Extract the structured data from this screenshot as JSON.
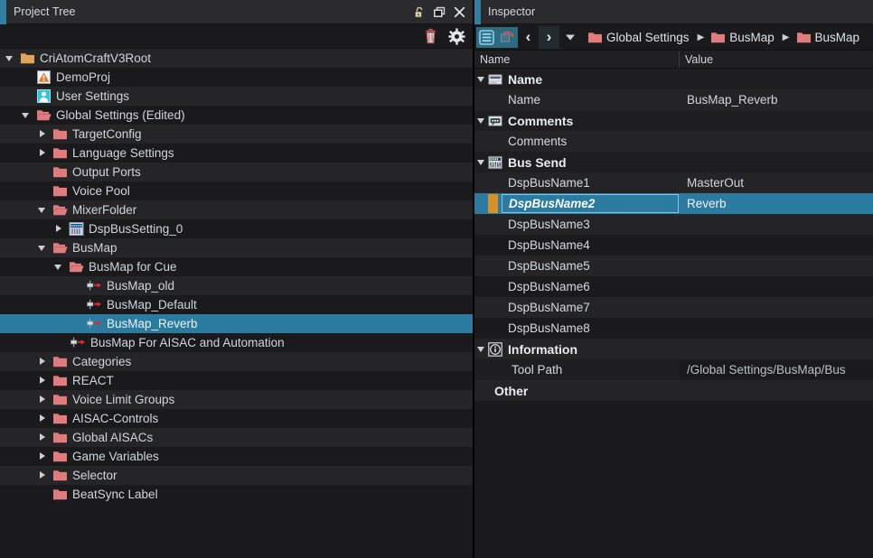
{
  "tree_panel": {
    "title": "Project Tree",
    "title_buttons": [
      "lock-icon",
      "restore-icon",
      "close-icon"
    ],
    "toolbar": [
      "delete-icon",
      "settings-icon"
    ],
    "items": [
      {
        "label": "CriAtomCraftV3Root",
        "indent": 0,
        "arrow": "open",
        "icon": "folder-orange",
        "selected": false
      },
      {
        "label": "DemoProj",
        "indent": 1,
        "arrow": "none",
        "icon": "project-icon",
        "selected": false
      },
      {
        "label": "User Settings",
        "indent": 1,
        "arrow": "none",
        "icon": "user-icon",
        "selected": false
      },
      {
        "label": "Global Settings (Edited)",
        "indent": 1,
        "arrow": "open",
        "icon": "folder-open-red",
        "selected": false
      },
      {
        "label": "TargetConfig",
        "indent": 2,
        "arrow": "closed",
        "icon": "folder-red",
        "selected": false
      },
      {
        "label": "Language Settings",
        "indent": 2,
        "arrow": "closed",
        "icon": "folder-red",
        "selected": false
      },
      {
        "label": "Output Ports",
        "indent": 2,
        "arrow": "none",
        "icon": "folder-red",
        "selected": false
      },
      {
        "label": "Voice Pool",
        "indent": 2,
        "arrow": "none",
        "icon": "folder-red",
        "selected": false
      },
      {
        "label": "MixerFolder",
        "indent": 2,
        "arrow": "open",
        "icon": "folder-open-red",
        "selected": false
      },
      {
        "label": "DspBusSetting_0",
        "indent": 3,
        "arrow": "closed",
        "icon": "dspbus-icon",
        "selected": false
      },
      {
        "label": "BusMap",
        "indent": 2,
        "arrow": "open",
        "icon": "folder-open-red",
        "selected": false
      },
      {
        "label": "BusMap for Cue",
        "indent": 3,
        "arrow": "open",
        "icon": "folder-open-red",
        "selected": false
      },
      {
        "label": "BusMap_old",
        "indent": 4,
        "arrow": "none",
        "icon": "busmap-icon",
        "selected": false
      },
      {
        "label": "BusMap_Default",
        "indent": 4,
        "arrow": "none",
        "icon": "busmap-icon",
        "selected": false
      },
      {
        "label": "BusMap_Reverb",
        "indent": 4,
        "arrow": "none",
        "icon": "busmap-icon",
        "selected": true
      },
      {
        "label": "BusMap For AISAC and Automation",
        "indent": 3,
        "arrow": "none",
        "icon": "busmap-icon",
        "selected": false
      },
      {
        "label": "Categories",
        "indent": 2,
        "arrow": "closed",
        "icon": "folder-red",
        "selected": false
      },
      {
        "label": "REACT",
        "indent": 2,
        "arrow": "closed",
        "icon": "folder-red",
        "selected": false
      },
      {
        "label": "Voice Limit Groups",
        "indent": 2,
        "arrow": "closed",
        "icon": "folder-red",
        "selected": false
      },
      {
        "label": "AISAC-Controls",
        "indent": 2,
        "arrow": "closed",
        "icon": "folder-red",
        "selected": false
      },
      {
        "label": "Global AISACs",
        "indent": 2,
        "arrow": "closed",
        "icon": "folder-red",
        "selected": false
      },
      {
        "label": "Game Variables",
        "indent": 2,
        "arrow": "closed",
        "icon": "folder-red",
        "selected": false
      },
      {
        "label": "Selector",
        "indent": 2,
        "arrow": "closed",
        "icon": "folder-red",
        "selected": false
      },
      {
        "label": "BeatSync Label",
        "indent": 2,
        "arrow": "none",
        "icon": "folder-red",
        "selected": false
      }
    ]
  },
  "inspector": {
    "title": "Inspector",
    "toolbar": {
      "list_view_label": "list-view-icon",
      "revert_label": "revert-icon",
      "back_label": "‹",
      "forward_label": "›",
      "dropdown_label": "chevron-down-icon"
    },
    "breadcrumb": [
      {
        "label": "Global Settings"
      },
      {
        "label": "BusMap"
      },
      {
        "label": "BusMap"
      }
    ],
    "breadcrumb_separator": "▶",
    "columns": {
      "name": "Name",
      "value": "Value"
    },
    "rows": [
      {
        "kind": "group",
        "label": "Name",
        "icon": "name-icon",
        "arrow": "open"
      },
      {
        "kind": "item",
        "label": "Name",
        "value": "BusMap_Reverb"
      },
      {
        "kind": "group",
        "label": "Comments",
        "icon": "comments-icon",
        "arrow": "open"
      },
      {
        "kind": "item",
        "label": "Comments",
        "value": ""
      },
      {
        "kind": "group",
        "label": "Bus Send",
        "icon": "bussend-icon",
        "arrow": "open"
      },
      {
        "kind": "item",
        "label": "DspBusName1",
        "value": "MasterOut"
      },
      {
        "kind": "item",
        "label": "DspBusName2",
        "value": "Reverb",
        "selected": true
      },
      {
        "kind": "item",
        "label": "DspBusName3",
        "value": ""
      },
      {
        "kind": "item",
        "label": "DspBusName4",
        "value": ""
      },
      {
        "kind": "item",
        "label": "DspBusName5",
        "value": ""
      },
      {
        "kind": "item",
        "label": "DspBusName6",
        "value": ""
      },
      {
        "kind": "item",
        "label": "DspBusName7",
        "value": ""
      },
      {
        "kind": "item",
        "label": "DspBusName8",
        "value": ""
      },
      {
        "kind": "group",
        "label": "Information",
        "icon": "info-icon",
        "arrow": "open"
      },
      {
        "kind": "toolpath",
        "label": "Tool Path",
        "value": "/Global Settings/BusMap/Bus"
      },
      {
        "kind": "group_plain",
        "label": "Other"
      }
    ]
  },
  "colors": {
    "background": "#1a1a1c",
    "row_alt": "#252527",
    "selection": "#2b7ba0",
    "title_bar": "#2b2b2e",
    "accent": "#2f7fa0",
    "folder_red": "#e07b7e",
    "folder_orange": "#e0a35c",
    "marker_orange": "#d79127"
  }
}
